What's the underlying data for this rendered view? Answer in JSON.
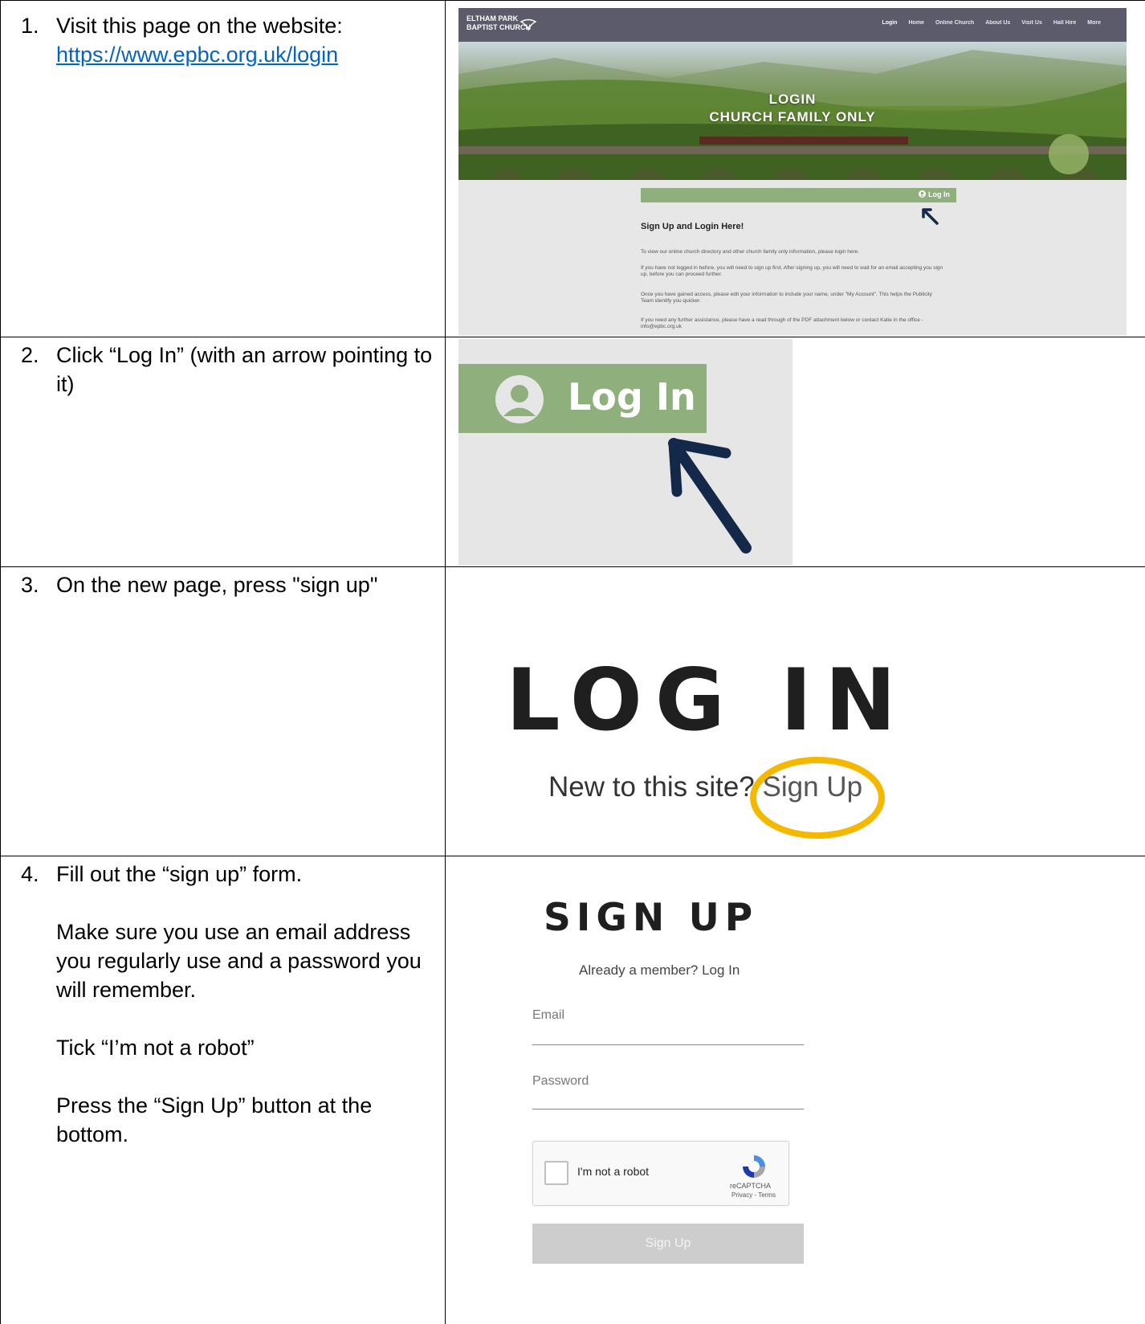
{
  "steps": [
    {
      "number": "1.",
      "text": "Visit this page on the website:",
      "link": "https://www.epbc.org.uk/login",
      "screenshot": {
        "brand_line1": "ELTHAM PARK",
        "brand_line2": "BAPTIST CHURCH",
        "nav": [
          "Login",
          "Home",
          "Online Church",
          "About Us",
          "Visit Us",
          "Hall Hire",
          "More"
        ],
        "hero_line1": "LOGIN",
        "hero_line2": "CHURCH FAMILY ONLY",
        "login_button": "Log In",
        "heading": "Sign Up and Login Here!",
        "paragraphs": [
          "To view our online church directory and other church family only information, please login here.",
          "If you have not logged in before, you will need to sign up first. After signing up, you will need to wait for an email accepting you sign up, before you can proceed further.",
          "Once you have gained access, please edit your information to include your name, under \"My Account\". This helps the Publicity Team identify you quicker.",
          "If you need any further assistance, please have a read through of the PDF attachment below or contact Katie in the office - info@epbc.org.uk"
        ]
      }
    },
    {
      "number": "2.",
      "text": "Click “Log In” (with an arrow pointing to it)",
      "screenshot": {
        "login_button": "Log In"
      }
    },
    {
      "number": "3.",
      "text": "On the new page, press \"sign up\"",
      "screenshot": {
        "title": "LOG IN",
        "prompt": "New to this site?",
        "link": "Sign Up"
      }
    },
    {
      "number": "4.",
      "text": "Fill out the “sign up” form.",
      "text2": "Make sure you use an email address you regularly use and a password you will remember.",
      "text3": "Tick “I’m not a robot”",
      "text4": "Press the “Sign Up” button at the bottom.",
      "screenshot": {
        "title": "SIGN UP",
        "already": "Already a member? Log In",
        "email_label": "Email",
        "password_label": "Password",
        "captcha_label": "I'm not a robot",
        "captcha_brand": "reCAPTCHA",
        "captcha_terms": "Privacy - Terms",
        "signup_button": "Sign Up"
      }
    }
  ],
  "colors": {
    "login_green": "#8fb07c",
    "arrow_navy": "#14294a",
    "highlight_circle": "#f5b800",
    "link_blue": "#0563c1"
  }
}
